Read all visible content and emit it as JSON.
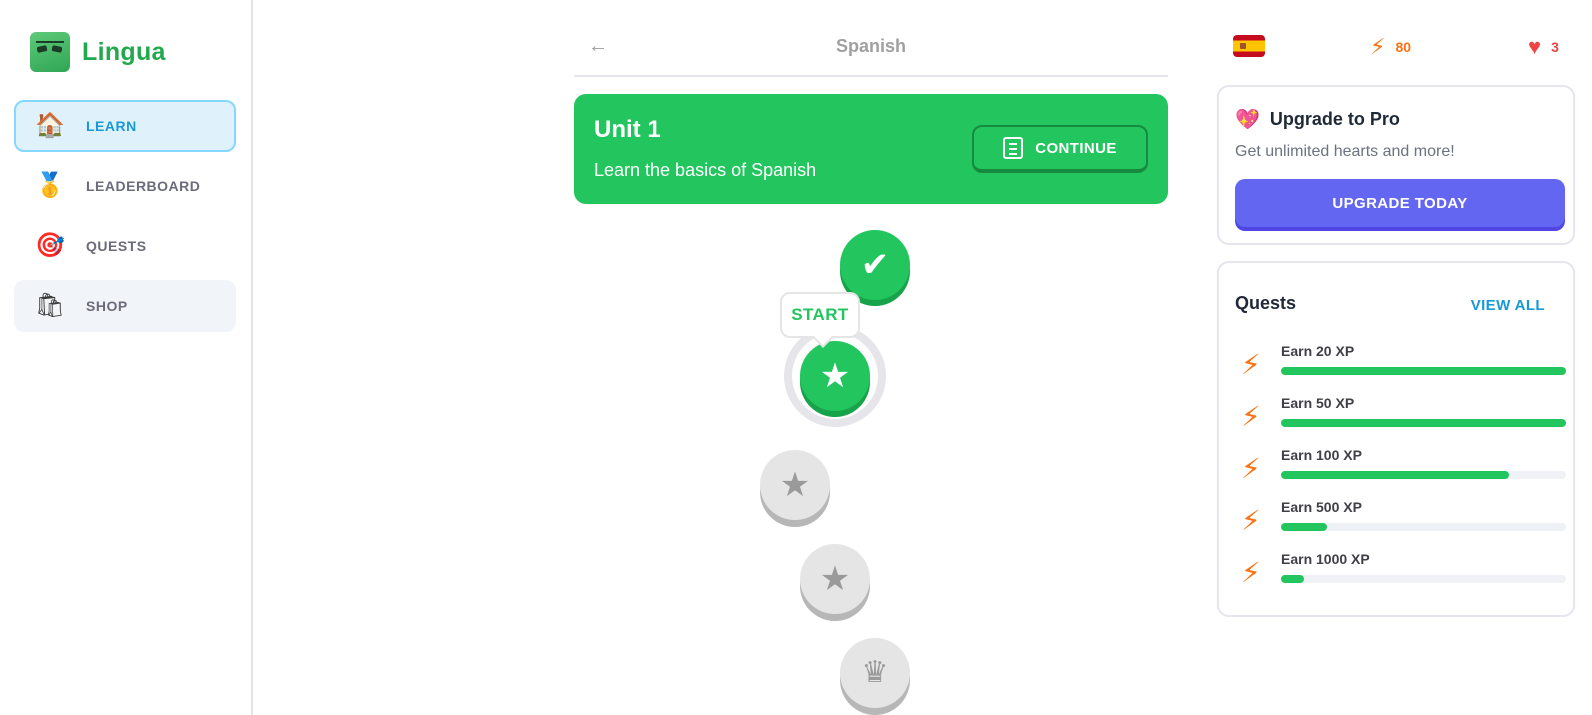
{
  "app": {
    "name": "Lingua"
  },
  "sidebar": {
    "items": [
      {
        "label": "LEARN",
        "icon": "house-icon",
        "active": true
      },
      {
        "label": "LEADERBOARD",
        "icon": "medal-icon",
        "active": false
      },
      {
        "label": "QUESTS",
        "icon": "target-icon",
        "active": false
      },
      {
        "label": "SHOP",
        "icon": "shopping-bag-icon",
        "active": false
      }
    ]
  },
  "header": {
    "title": "Spanish",
    "back_icon": "arrow-left-icon"
  },
  "unit": {
    "title": "Unit 1",
    "description": "Learn the basics of Spanish",
    "continue_label": "CONTINUE"
  },
  "path": {
    "start_label": "START",
    "nodes": [
      {
        "state": "completed",
        "icon": "check-icon"
      },
      {
        "state": "current",
        "icon": "star-icon"
      },
      {
        "state": "locked",
        "icon": "star-icon"
      },
      {
        "state": "locked",
        "icon": "star-icon"
      },
      {
        "state": "locked",
        "icon": "crown-icon"
      }
    ]
  },
  "stats": {
    "language_flag": "spain-flag-icon",
    "xp": "80",
    "hearts": "3"
  },
  "promo": {
    "title": "Upgrade to Pro",
    "subtitle": "Get unlimited hearts and more!",
    "button_label": "UPGRADE TODAY"
  },
  "quests": {
    "title": "Quests",
    "view_all_label": "VIEW ALL",
    "items": [
      {
        "label": "Earn 20 XP",
        "progress": 1.0
      },
      {
        "label": "Earn 50 XP",
        "progress": 1.0
      },
      {
        "label": "Earn 100 XP",
        "progress": 0.8
      },
      {
        "label": "Earn 500 XP",
        "progress": 0.16
      },
      {
        "label": "Earn 1000 XP",
        "progress": 0.08
      }
    ]
  },
  "colors": {
    "primary_green": "#22c55e",
    "accent_blue": "#1899d6",
    "upgrade_purple": "#6366f1",
    "xp_orange": "#f97316",
    "heart_red": "#ef4444"
  }
}
